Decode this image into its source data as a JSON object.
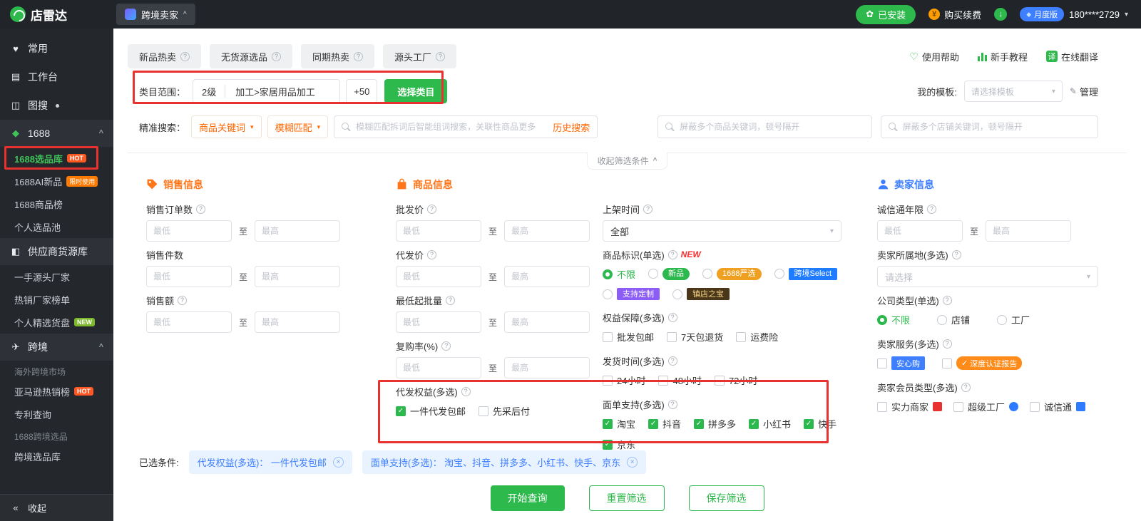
{
  "icons": {
    "info": "?",
    "check": "✓",
    "caret_down": "▾",
    "caret_up": "^",
    "close": "×",
    "heart": "♥",
    "heart_outline": "♡",
    "workbench": "▤",
    "image_search": "◫",
    "cube": "◆",
    "supplier": "◧",
    "plane": "✈",
    "collapse": "«",
    "edit": "✎",
    "yuan": "¥",
    "flower": "✿",
    "translate": "译",
    "diamond": "◆",
    "down": "↓"
  },
  "topbar": {
    "logo": "店雷达",
    "workspace_tab": "跨境卖家",
    "installed": "已安装",
    "renew": "购买续费",
    "plan": "月度版",
    "phone": "180****2729"
  },
  "sidebar": {
    "top_items": [
      {
        "label": "常用"
      },
      {
        "label": "工作台"
      },
      {
        "label": "图搜"
      }
    ],
    "group_1688": {
      "label": "1688",
      "children": [
        {
          "label": "1688选品库",
          "badge": "HOT",
          "active": true
        },
        {
          "label": "1688AI新品",
          "badge": "限时使用"
        },
        {
          "label": "1688商品榜"
        },
        {
          "label": "个人选品池"
        }
      ]
    },
    "group_supplier": {
      "label": "供应商货源库",
      "children": [
        {
          "label": "一手源头厂家"
        },
        {
          "label": "热销厂家榜单"
        },
        {
          "label": "个人精选货盘",
          "badge": "NEW"
        }
      ]
    },
    "group_cross": {
      "label": "跨境",
      "sub1": "海外跨境市场",
      "sub1_children": [
        {
          "label": "亚马逊热销榜",
          "badge": "HOT"
        },
        {
          "label": "专利查询"
        }
      ],
      "sub2": "1688跨境选品",
      "sub2_children": [
        {
          "label": "跨境选品库"
        }
      ]
    },
    "collapse": "收起"
  },
  "tabs": [
    {
      "label": "新品热卖"
    },
    {
      "label": "无货源选品"
    },
    {
      "label": "同期热卖"
    },
    {
      "label": "源头工厂"
    }
  ],
  "help": {
    "usage": "使用帮助",
    "tutorial": "新手教程",
    "translate": "在线翻译"
  },
  "category": {
    "label": "类目范围：",
    "level": "2级",
    "path": "加工>家居用品加工",
    "more": "+50",
    "select_button": "选择类目"
  },
  "template": {
    "label": "我的模板:",
    "placeholder": "请选择模板",
    "manage": "管理"
  },
  "search": {
    "label": "精准搜索：",
    "keyword_type": "商品关键词",
    "match_type": "模糊匹配",
    "main_placeholder": "模糊匹配拆词后智能组词搜索，关联性商品更多",
    "history": "历史搜索",
    "block_products_placeholder": "屏蔽多个商品关键词，顿号隔开",
    "block_shops_placeholder": "屏蔽多个店铺关键词，顿号隔开"
  },
  "collapse_bar": "收起筛选条件",
  "ph": {
    "min": "最低",
    "max": "最高",
    "to": "至"
  },
  "sales": {
    "title": "销售信息",
    "fields": [
      {
        "label": "销售订单数",
        "info": true
      },
      {
        "label": "销售件数",
        "info": false
      },
      {
        "label": "销售额",
        "info": true
      }
    ]
  },
  "product": {
    "title": "商品信息",
    "fields": [
      {
        "label": "批发价"
      },
      {
        "label": "代发价"
      },
      {
        "label": "最低起批量"
      },
      {
        "label": "复购率(%)"
      }
    ],
    "dropship_label": "代发权益(多选)",
    "dropship_options": [
      {
        "label": "一件代发包邮",
        "checked": true
      },
      {
        "label": "先采后付",
        "checked": false
      }
    ]
  },
  "listing": {
    "shelf_label": "上架时间",
    "shelf_value": "全部",
    "tags_label": "商品标识(单选)",
    "tags_new": "NEW",
    "tags": [
      {
        "label": "不限",
        "selected": true
      },
      {
        "label": "新品",
        "selected": false
      },
      {
        "label": "1688严选",
        "selected": false
      },
      {
        "label": "跨境Select",
        "selected": false
      },
      {
        "label": "支持定制",
        "selected": false
      },
      {
        "label": "镇店之宝",
        "selected": false
      }
    ],
    "guarantee_label": "权益保障(多选)",
    "guarantees": [
      {
        "label": "批发包邮",
        "checked": false
      },
      {
        "label": "7天包退货",
        "checked": false
      },
      {
        "label": "运费险",
        "checked": false
      }
    ],
    "shiptime_label": "发货时间(多选)",
    "shiptimes": [
      {
        "label": "24小时",
        "checked": false
      },
      {
        "label": "48小时",
        "checked": false
      },
      {
        "label": "72小时",
        "checked": false
      }
    ],
    "waybill_label": "面单支持(多选)",
    "waybills": [
      {
        "label": "淘宝",
        "checked": true
      },
      {
        "label": "抖音",
        "checked": true
      },
      {
        "label": "拼多多",
        "checked": true
      },
      {
        "label": "小红书",
        "checked": true
      },
      {
        "label": "快手",
        "checked": true
      },
      {
        "label": "京东",
        "checked": true
      }
    ]
  },
  "seller": {
    "title": "卖家信息",
    "cxt_label": "诚信通年限",
    "location_label": "卖家所属地(多选)",
    "location_placeholder": "请选择",
    "company_label": "公司类型(单选)",
    "company_options": [
      {
        "label": "不限",
        "selected": true
      },
      {
        "label": "店铺",
        "selected": false
      },
      {
        "label": "工厂",
        "selected": false
      }
    ],
    "service_label": "卖家服务(多选)",
    "services": [
      {
        "label": "安心购",
        "checked": false
      },
      {
        "label": "深度认证报告",
        "checked": false
      }
    ],
    "member_label": "卖家会员类型(多选)",
    "members": [
      {
        "label": "实力商家",
        "checked": false
      },
      {
        "label": "超级工厂",
        "checked": false
      },
      {
        "label": "诚信通",
        "checked": false
      }
    ]
  },
  "selected": {
    "label": "已选条件:",
    "chips": [
      "代发权益(多选)： 一件代发包邮",
      "面单支持(多选)： 淘宝、抖音、拼多多、小红书、快手、京东"
    ]
  },
  "actions": {
    "query": "开始查询",
    "reset": "重置筛选",
    "save": "保存筛选"
  }
}
